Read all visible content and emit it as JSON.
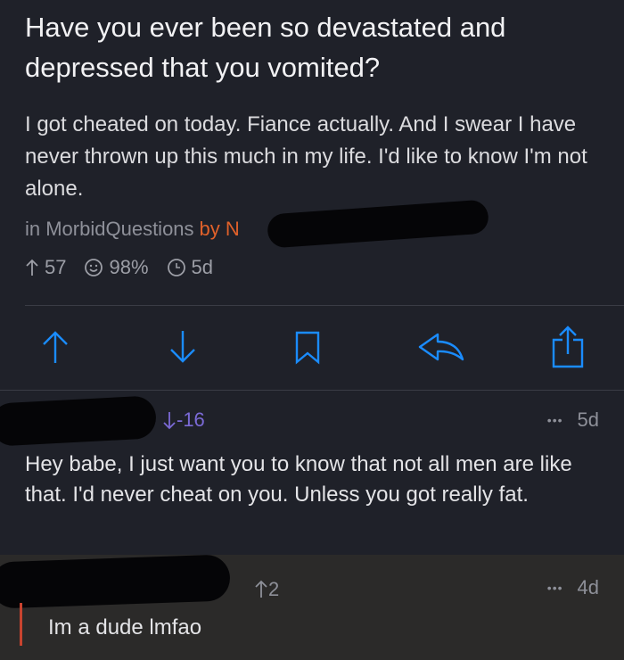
{
  "post": {
    "title": "Have you ever been so devastated and depressed that you vomited?",
    "body": "I got cheated on today. Fiance actually. And I swear I have never thrown up this much in my life. I'd like to know I'm not alone.",
    "subreddit_prefix": "in MorbidQuestions",
    "author_prefix": "by N",
    "upvotes": "57",
    "upvote_ratio": "98%",
    "age": "5d"
  },
  "actions": {
    "upvote_icon": "arrow-up-icon",
    "downvote_icon": "arrow-down-icon",
    "save_icon": "bookmark-icon",
    "reply_icon": "reply-icon",
    "share_icon": "share-icon",
    "accent": "#1a8cff"
  },
  "comments": [
    {
      "score": "-16",
      "age": "5d",
      "more": "•••",
      "text": "Hey babe, I just want you to know that not all men are like that. I'd never cheat on you. Unless you got really fat."
    },
    {
      "score": "2",
      "age": "4d",
      "more": "•••",
      "text": "Im a dude lmfao"
    }
  ],
  "colors": {
    "background": "#1f2129",
    "author": "#e0612a",
    "downvoted": "#7b6ad6",
    "highlight_bar": "#c8432f"
  }
}
